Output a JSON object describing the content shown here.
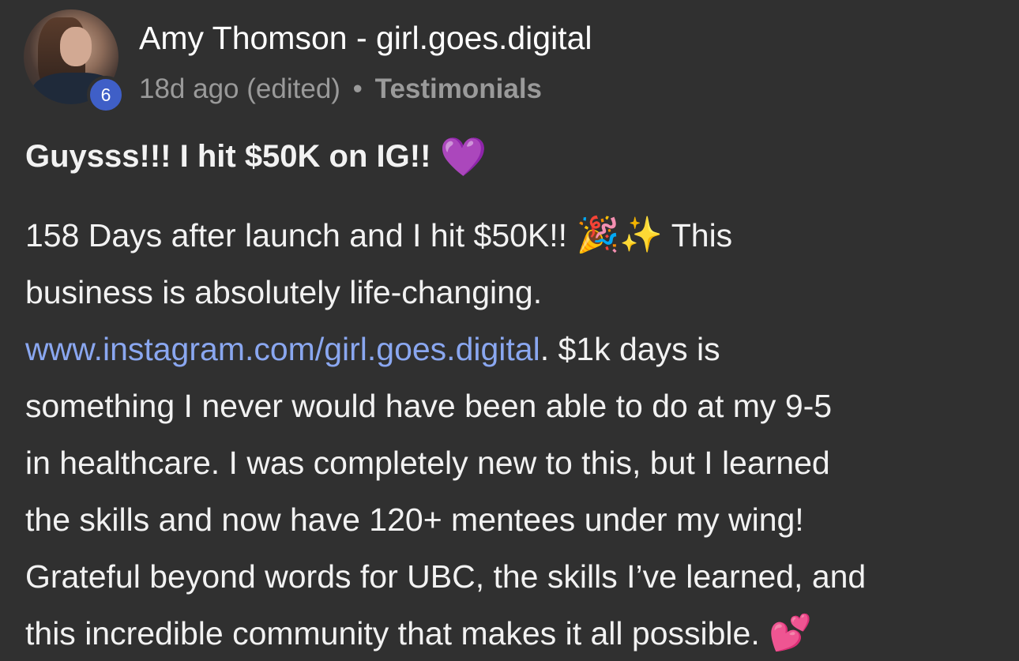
{
  "post": {
    "author_name": "Amy Thomson - girl.goes.digital",
    "level": "6",
    "time_ago": "18d ago",
    "edited": "(edited)",
    "separator": "•",
    "category": "Testimonials",
    "title": "Guysss!!! I hit $50K on IG!!",
    "title_emoji": "💜",
    "body": {
      "line1_text": "158 Days after launch and I hit $50K!!",
      "line1_emoji_party": "🎉",
      "line1_emoji_sparkles": "✨",
      "line1_end": "This",
      "line2": "business is absolutely life-changing.",
      "line3_link": "www.instagram.com/girl.goes.digital",
      "line3_rest": ". $1k days is",
      "line4": "something I never would have been able to do at my 9-5",
      "line5": "in healthcare. I was completely new to this, but I learned",
      "line6": "the skills and now have 120+ mentees under my wing!",
      "line7": "Grateful beyond words for UBC, the skills I’ve learned, and",
      "line8_text": "this incredible community that makes it all possible.",
      "line8_emoji": "💕"
    }
  },
  "colors": {
    "background": "#303030",
    "link": "#8aa7f0",
    "level_badge": "#3f5fc7",
    "meta_text": "#9a9a9a"
  }
}
